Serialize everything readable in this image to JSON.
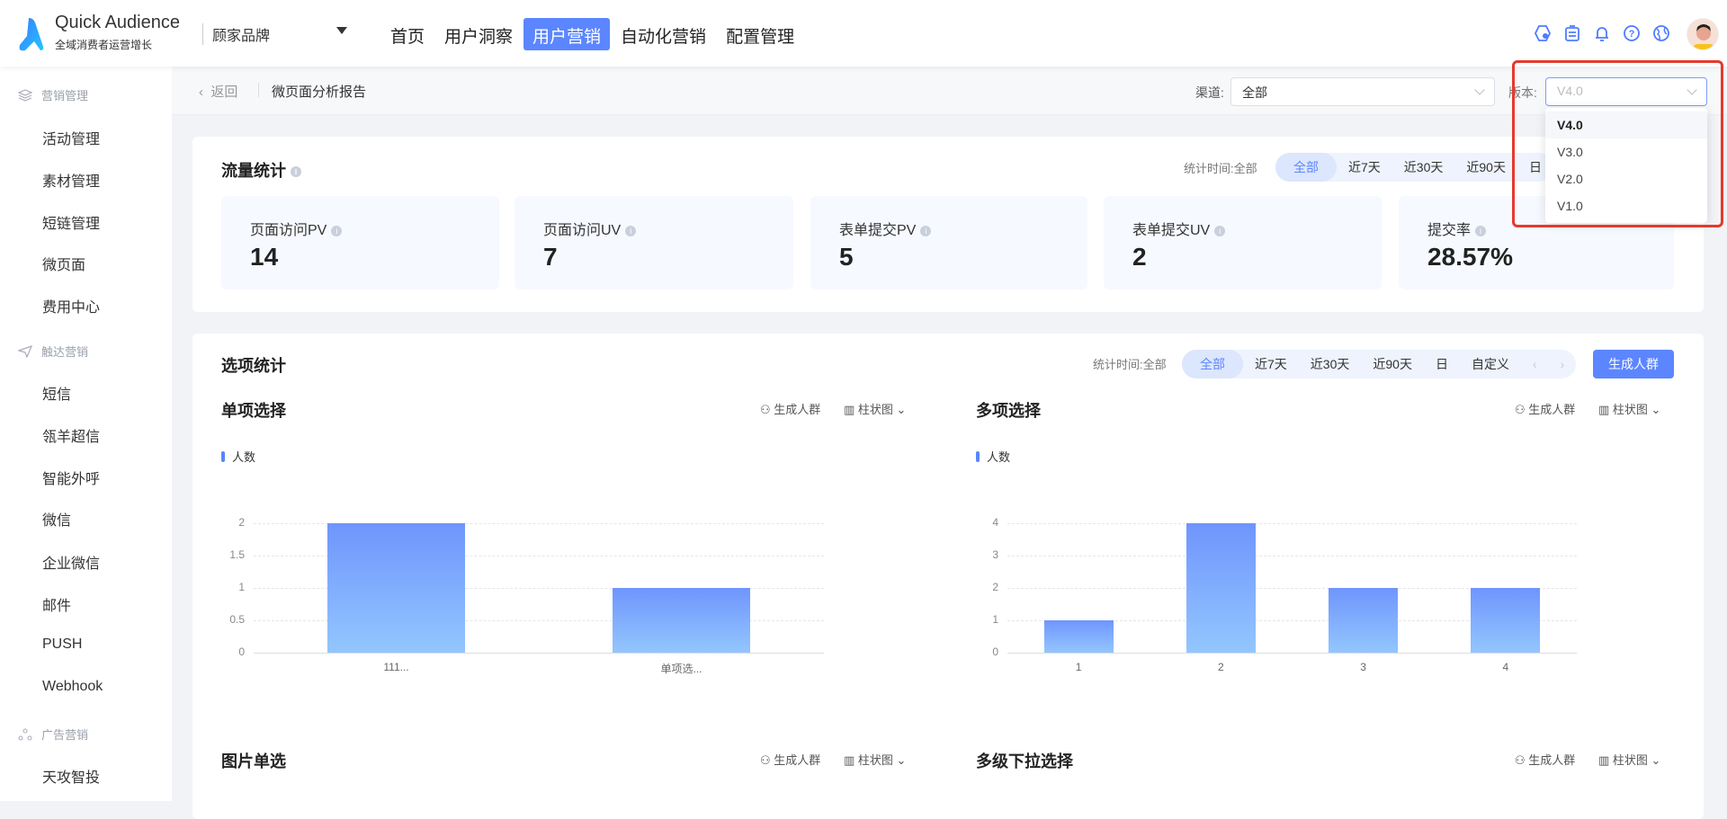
{
  "header": {
    "app_title": "Quick Audience",
    "app_subtitle": "全域消费者运营增长",
    "brand": "顾家品牌",
    "nav": [
      "首页",
      "用户洞察",
      "用户营销",
      "自动化营销",
      "配置管理"
    ],
    "active_nav": 2,
    "icons": [
      "settings-hexagon-icon",
      "clipboard-icon",
      "bell-icon",
      "help-icon",
      "globe-icon"
    ]
  },
  "sidebar": {
    "groups": [
      {
        "label": "营销管理",
        "icon": "layers-icon",
        "items": [
          "活动管理",
          "素材管理",
          "短链管理",
          "微页面",
          "费用中心"
        ]
      },
      {
        "label": "触达营销",
        "icon": "send-icon",
        "items": [
          "短信",
          "瓴羊超信",
          "智能外呼",
          "微信",
          "企业微信",
          "邮件",
          "PUSH",
          "Webhook"
        ]
      },
      {
        "label": "广告营销",
        "icon": "share-nodes-icon",
        "items": [
          "天攻智投"
        ]
      }
    ]
  },
  "subbar": {
    "back": "返回",
    "title": "微页面分析报告",
    "channel_label": "渠道:",
    "channel_value": "全部",
    "version_label": "版本:",
    "version_value": "V4.0",
    "version_options": [
      "V4.0",
      "V3.0",
      "V2.0",
      "V1.0"
    ]
  },
  "traffic": {
    "title": "流量统计",
    "time_label": "统计时间:全部",
    "pills": [
      "全部",
      "近7天",
      "近30天",
      "近90天",
      "日"
    ],
    "stats": [
      {
        "label": "页面访问PV",
        "value": "14"
      },
      {
        "label": "页面访问UV",
        "value": "7"
      },
      {
        "label": "表单提交PV",
        "value": "5"
      },
      {
        "label": "表单提交UV",
        "value": "2"
      },
      {
        "label": "提交率",
        "value": "28.57%"
      }
    ]
  },
  "options": {
    "title": "选项统计",
    "time_label": "统计时间:全部",
    "pills": [
      "全部",
      "近7天",
      "近30天",
      "近90天",
      "日",
      "自定义"
    ],
    "generate_btn": "生成人群",
    "action_generate": "生成人群",
    "action_chart": "柱状图",
    "more_titles": [
      "图片单选",
      "多级下拉选择"
    ]
  },
  "colors": {
    "accent": "#5b86ff",
    "highlight": "#e53a2d"
  },
  "chart_data": [
    {
      "type": "bar",
      "title": "单项选择",
      "legend": "人数",
      "categories": [
        "111...",
        "单项选..."
      ],
      "values": [
        2,
        1
      ],
      "yticks": [
        "0",
        "0.5",
        "1",
        "1.5",
        "2"
      ],
      "ylim": [
        0,
        2
      ]
    },
    {
      "type": "bar",
      "title": "多项选择",
      "legend": "人数",
      "categories": [
        "1",
        "2",
        "3",
        "4"
      ],
      "values": [
        1,
        4,
        2,
        2
      ],
      "yticks": [
        "0",
        "1",
        "2",
        "3",
        "4"
      ],
      "ylim": [
        0,
        4
      ]
    }
  ]
}
